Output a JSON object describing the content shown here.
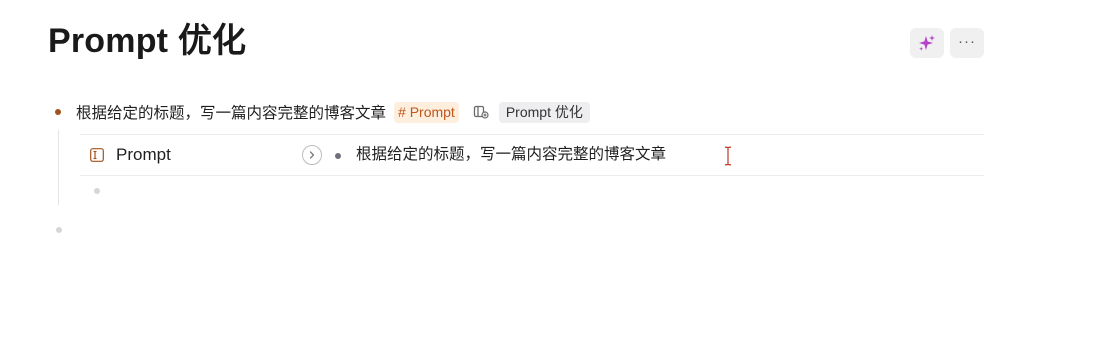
{
  "page": {
    "title": "Prompt 优化"
  },
  "toolbar": {
    "ai_icon": "sparkle-icon",
    "more_label": "···"
  },
  "outline": {
    "node1": {
      "text": "根据给定的标题，写一篇内容完整的博客文章",
      "tag": "# Prompt",
      "ref_icon": "reference-icon",
      "ref_label": "Prompt 优化",
      "bullet_color": "#a2521b"
    },
    "field": {
      "icon": "text-field-icon",
      "name": "Prompt",
      "value": "根据给定的标题，写一篇内容完整的博客文章"
    }
  },
  "colors": {
    "tag_bg": "#fdeede",
    "tag_text": "#c0571c",
    "ai_accent": "#b443c9"
  }
}
